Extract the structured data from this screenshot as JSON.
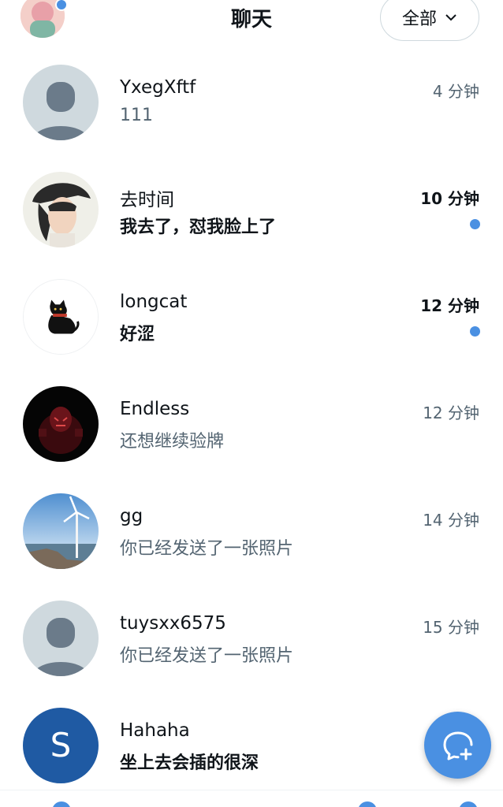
{
  "header": {
    "title": "聊天",
    "filter_label": "全部"
  },
  "colors": {
    "accent": "#4a90e2",
    "text_primary": "#0f1419",
    "text_secondary": "#536471"
  },
  "chats": [
    {
      "name": "YxegXftf",
      "preview": "111",
      "time": "4 分钟",
      "unread": false,
      "avatar": "default-avatar"
    },
    {
      "name": "去时间",
      "preview": "我去了，怼我脸上了",
      "time": "10 分钟",
      "unread": true,
      "avatar": "photo-avatar"
    },
    {
      "name": "longcat",
      "preview": "好涩",
      "time": "12 分钟",
      "unread": true,
      "avatar": "black-cat-avatar"
    },
    {
      "name": "Endless",
      "preview": "还想继续验牌",
      "time": "12 分钟",
      "unread": false,
      "avatar": "dark-mask-avatar"
    },
    {
      "name": "gg",
      "preview": "你已经发送了一张照片",
      "time": "14 分钟",
      "unread": false,
      "avatar": "wind-turbine-avatar"
    },
    {
      "name": "tuysxx6575",
      "preview": "你已经发送了一张照片",
      "time": "15 分钟",
      "unread": false,
      "avatar": "default-avatar"
    },
    {
      "name": "Hahaha",
      "preview": "坐上去会插的很深",
      "time": "",
      "unread": false,
      "avatar": "letter-avatar",
      "avatar_letter": "S"
    }
  ],
  "fab": {
    "icon": "new-message-icon"
  }
}
